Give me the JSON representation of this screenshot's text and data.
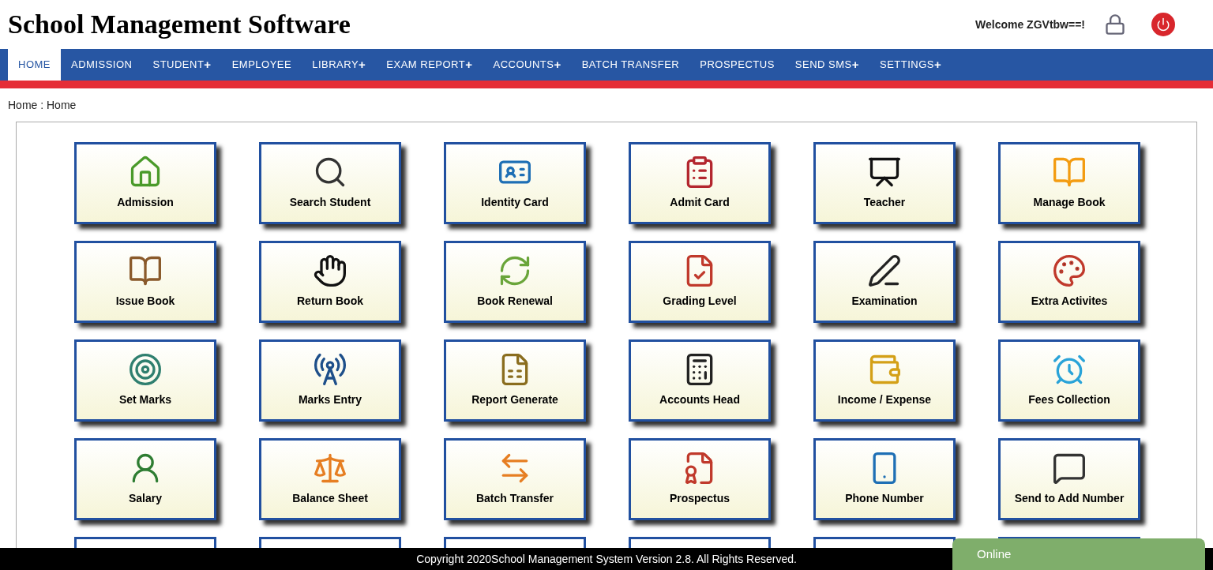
{
  "header": {
    "title": "School Management Software",
    "welcome": "Welcome ZGVtbw==!"
  },
  "nav": [
    {
      "label": "HOME",
      "selected": true
    },
    {
      "label": "ADMISSION",
      "selected": false
    },
    {
      "label": "STUDENT",
      "marker": "+",
      "selected": false
    },
    {
      "label": "EMPLOYEE",
      "selected": false
    },
    {
      "label": "LIBRARY",
      "marker": "+",
      "selected": false
    },
    {
      "label": "EXAM REPORT",
      "marker": "+",
      "selected": false
    },
    {
      "label": "ACCOUNTS",
      "marker": "+",
      "selected": false
    },
    {
      "label": "BATCH TRANSFER",
      "selected": false
    },
    {
      "label": "PROSPECTUS",
      "selected": false
    },
    {
      "label": "SEND SMS",
      "marker": "+",
      "selected": false
    },
    {
      "label": "SETTINGS",
      "marker": "+",
      "selected": false
    }
  ],
  "breadcrumb": "Home : Home",
  "tiles": [
    {
      "label": "Admission"
    },
    {
      "label": "Search Student"
    },
    {
      "label": "Identity Card"
    },
    {
      "label": "Admit Card"
    },
    {
      "label": "Teacher"
    },
    {
      "label": "Manage Book"
    },
    {
      "label": "Issue Book"
    },
    {
      "label": "Return Book"
    },
    {
      "label": "Book Renewal"
    },
    {
      "label": "Grading Level"
    },
    {
      "label": "Examination"
    },
    {
      "label": "Extra Activites"
    },
    {
      "label": "Set Marks"
    },
    {
      "label": "Marks Entry"
    },
    {
      "label": "Report Generate"
    },
    {
      "label": "Accounts Head"
    },
    {
      "label": "Income / Expense"
    },
    {
      "label": "Fees Collection"
    },
    {
      "label": "Salary"
    },
    {
      "label": "Balance Sheet"
    },
    {
      "label": "Batch Transfer"
    },
    {
      "label": "Prospectus"
    },
    {
      "label": "Phone Number"
    },
    {
      "label": "Send to Add Number"
    }
  ],
  "footer": "Copyright 2020School Management System Version 2.8. All Rights Reserved.",
  "chat": {
    "label": "Online"
  }
}
